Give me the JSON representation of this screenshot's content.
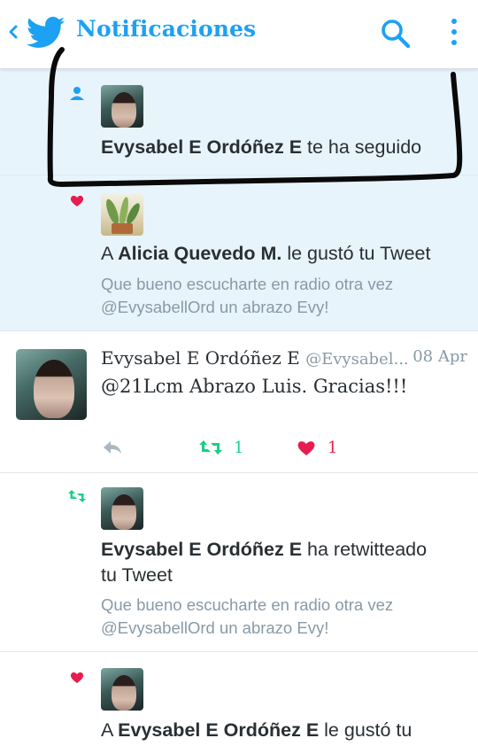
{
  "header": {
    "title": "Notificaciones",
    "back_icon": "chevron-left-icon",
    "logo_icon": "twitter-bird-icon",
    "search_icon": "search-icon",
    "more_icon": "more-vertical-icon"
  },
  "colors": {
    "accent": "#1da1f2",
    "unread_bg": "#e8f4fc",
    "retweet": "#19cf86",
    "like": "#e81c4f",
    "muted": "#8899a6"
  },
  "notifications": [
    {
      "type": "follow",
      "icon": "person-icon",
      "actor": "Evysabel E Ordóñez E",
      "action": "te ha seguido"
    },
    {
      "type": "like",
      "icon": "heart-icon",
      "prefix": "A",
      "actor": "Alicia Quevedo M.",
      "action": "le gustó tu Tweet",
      "quote_line1": "Que bueno escucharte en radio otra vez",
      "quote_line2": "@EvysabellOrd un abrazo Evy!"
    },
    {
      "type": "tweet",
      "name": "Evysabel E Ordóñez E",
      "handle": "@Evysabel...",
      "time": "08 Apr",
      "text": "@21Lcm Abrazo Luis. Gracias!!!",
      "retweets": "1",
      "likes": "1"
    },
    {
      "type": "retweet",
      "icon": "retweet-icon",
      "actor": "Evysabel E Ordóñez E",
      "action_line1": "ha retwitteado",
      "action_line2": "tu Tweet",
      "quote_line1": "Que bueno escucharte en radio otra vez",
      "quote_line2": "@EvysabellOrd un abrazo Evy!"
    },
    {
      "type": "like",
      "icon": "heart-icon",
      "prefix": "A",
      "actor": "Evysabel E Ordóñez E",
      "action": "le gustó tu"
    }
  ]
}
